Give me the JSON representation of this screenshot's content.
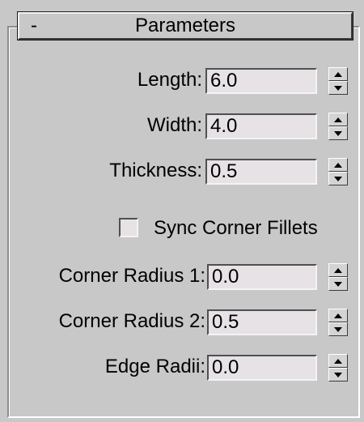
{
  "rollout": {
    "toggle": "-",
    "title": "Parameters"
  },
  "params": {
    "length": {
      "label": "Length:",
      "value": "6.0"
    },
    "width": {
      "label": "Width:",
      "value": "4.0"
    },
    "thickness": {
      "label": "Thickness:",
      "value": "0.5"
    },
    "corner_radius_1": {
      "label": "Corner Radius 1:",
      "value": "0.0"
    },
    "corner_radius_2": {
      "label": "Corner Radius 2:",
      "value": "0.5"
    },
    "edge_radii": {
      "label": "Edge Radii:",
      "value": "0.0"
    }
  },
  "sync_corner_fillets": {
    "label": "Sync Corner Fillets",
    "checked": false
  },
  "icons": {
    "spinner_up": "spinner-up-arrow-icon",
    "spinner_down": "spinner-down-arrow-icon"
  },
  "colors": {
    "panel_bg": "#c8c8c8",
    "field_bg": "#e6e2e6"
  }
}
